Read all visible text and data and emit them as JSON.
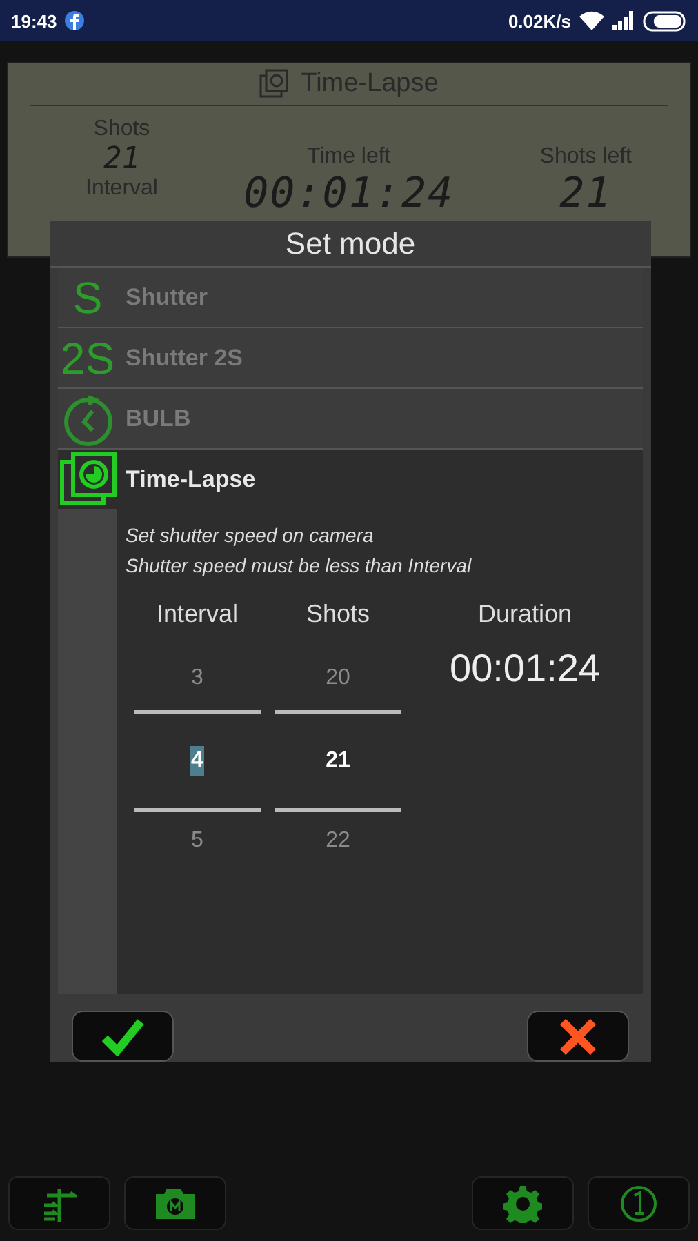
{
  "status_bar": {
    "time": "19:43",
    "speed": "0.02K/s"
  },
  "panel": {
    "mode_title": "Time-Lapse",
    "shots_label": "Shots",
    "shots_value": "21",
    "interval_label": "Interval",
    "time_left_label": "Time left",
    "time_left_value": "00:01:24",
    "shots_left_label": "Shots left",
    "shots_left_value": "21"
  },
  "dialog": {
    "title": "Set mode",
    "modes": [
      {
        "kind": "letters",
        "icon_text": "S",
        "label": "Shutter",
        "selected": false
      },
      {
        "kind": "letters",
        "icon_text": "2S",
        "label": "Shutter 2S",
        "selected": false
      },
      {
        "kind": "timer",
        "label": "BULB",
        "selected": false
      },
      {
        "kind": "timelapse",
        "label": "Time-Lapse",
        "selected": true
      }
    ],
    "notes": [
      "Set shutter speed on camera",
      "Shutter speed must be less than Interval"
    ],
    "pickers": [
      {
        "label": "Interval",
        "values": [
          {
            "text": "3",
            "selected": false
          },
          {
            "text": "4",
            "selected": true
          },
          {
            "text": "5",
            "selected": false
          }
        ]
      },
      {
        "label": "Shots",
        "values": [
          {
            "text": "20",
            "selected": false
          },
          {
            "text": "21",
            "selected": true
          },
          {
            "text": "22",
            "selected": false
          }
        ]
      }
    ],
    "duration_label": "Duration",
    "duration_value": "00:01:24"
  }
}
